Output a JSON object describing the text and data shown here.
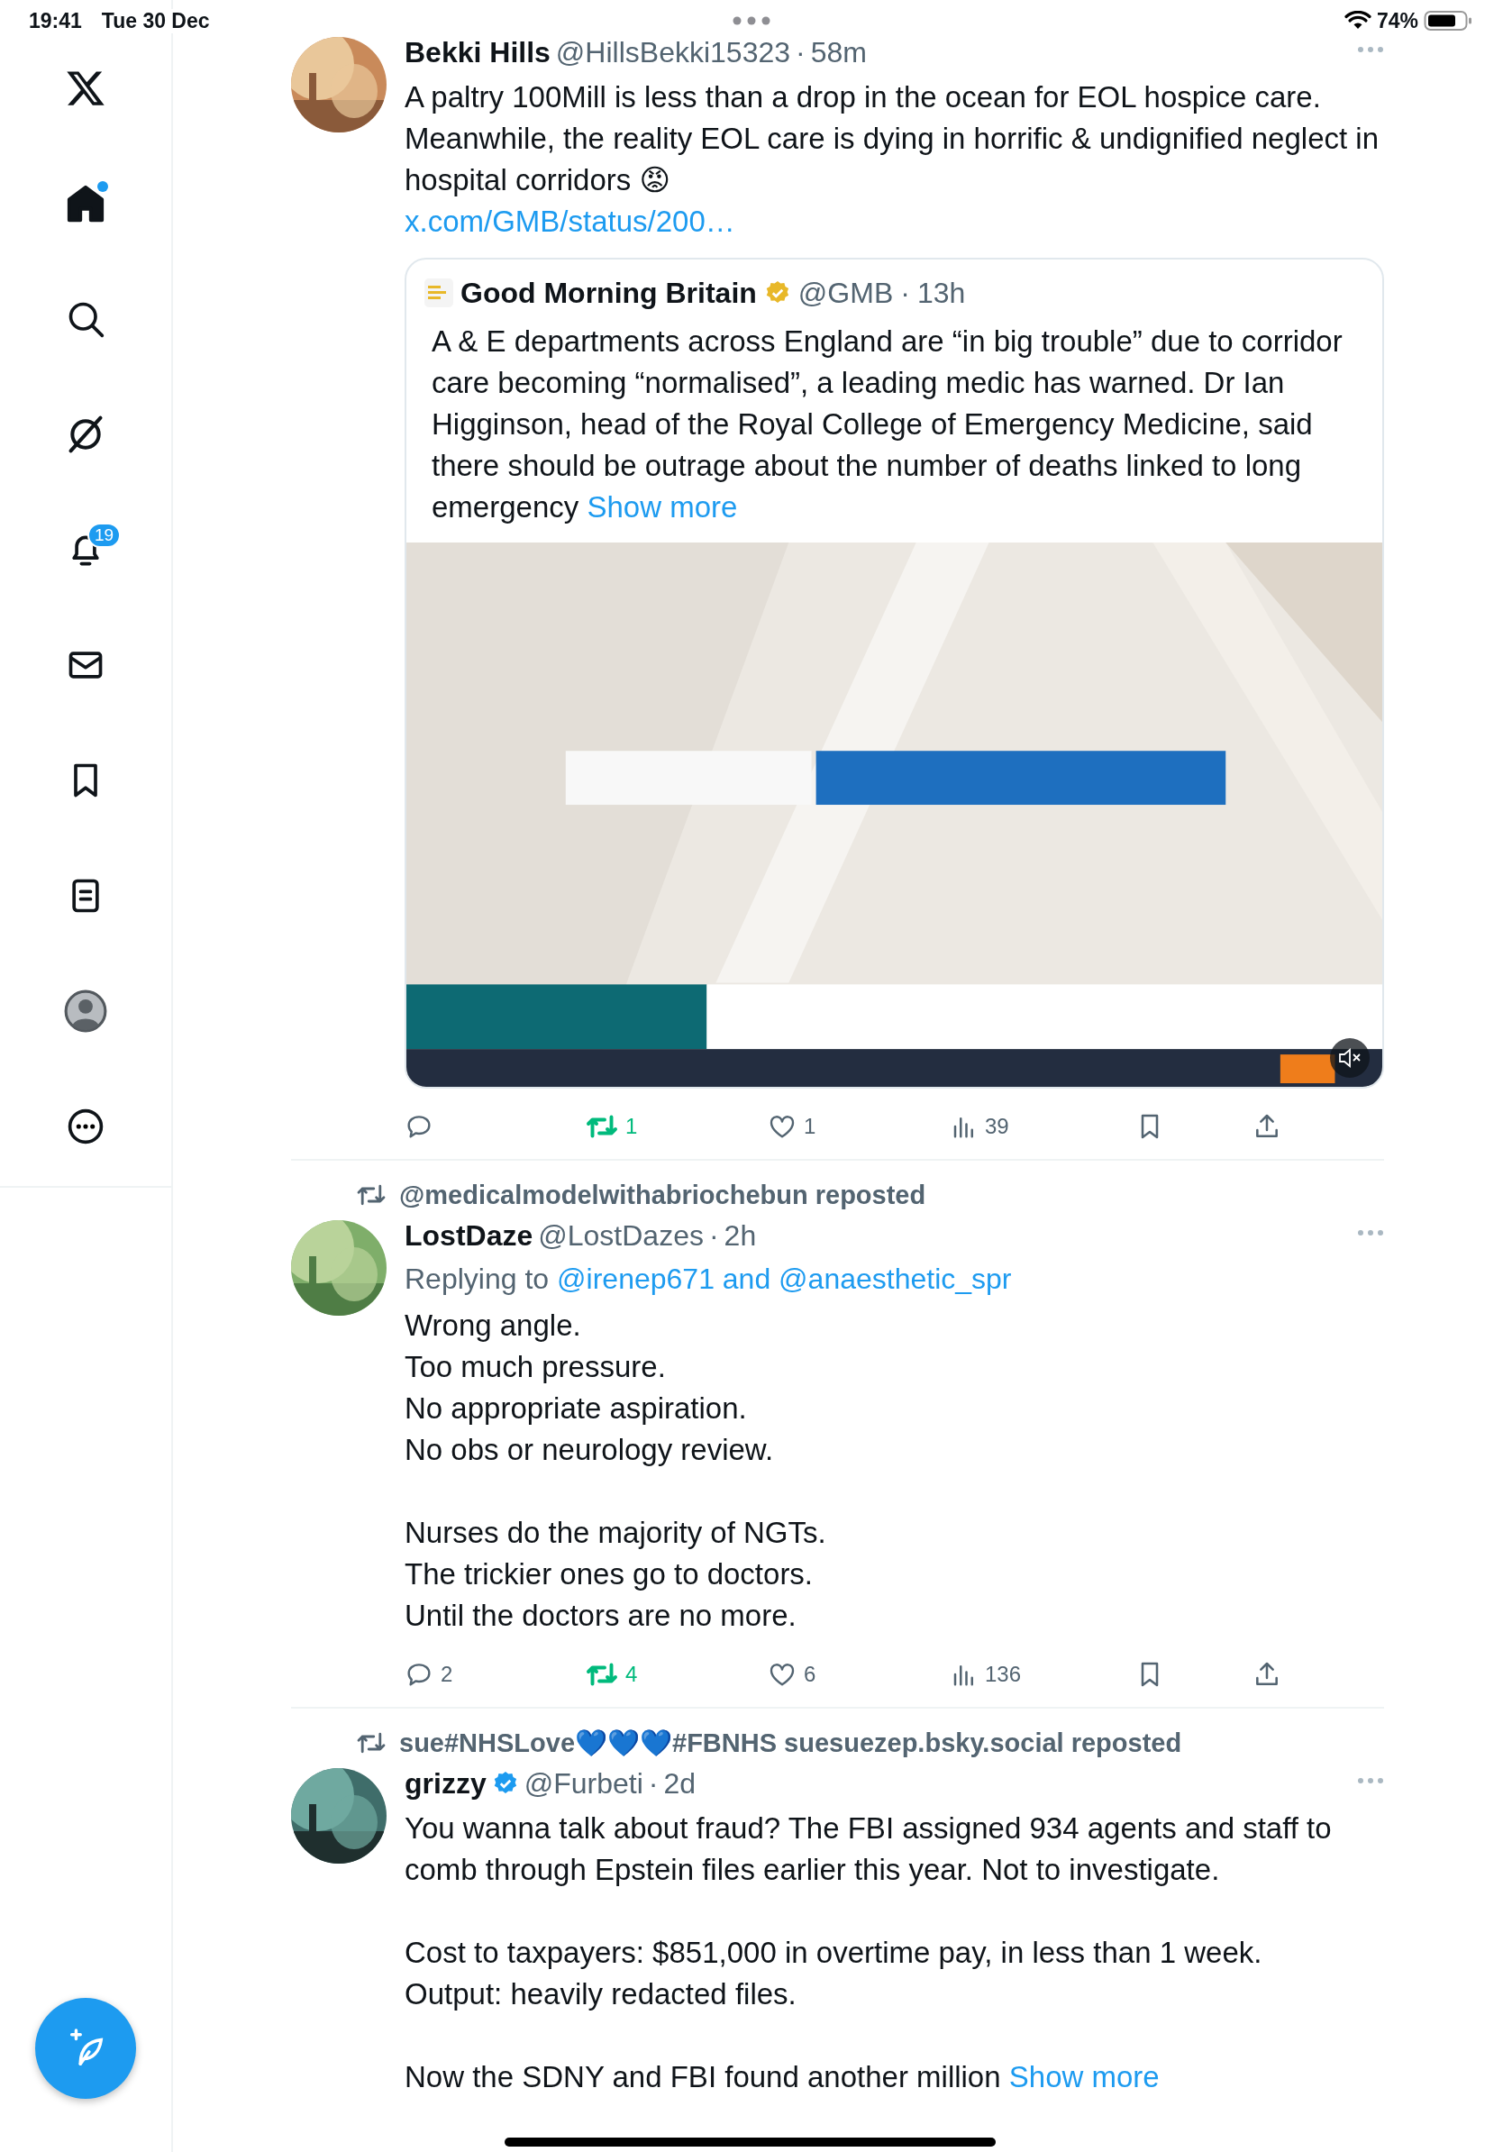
{
  "status_bar": {
    "time": "19:41",
    "date": "Tue 30 Dec",
    "battery": "74%"
  },
  "sidebar": {
    "items": [
      {
        "selected": false
      },
      {
        "selected": true,
        "unread": true
      },
      {
        "selected": false
      },
      {
        "selected": false
      },
      {
        "selected": false,
        "badge": "19"
      },
      {
        "selected": false
      },
      {
        "selected": false
      },
      {
        "selected": false
      },
      {
        "selected": false
      },
      {
        "selected": false
      }
    ]
  },
  "tweets": [
    {
      "author": "Bekki Hills",
      "handle": "@HillsBekki15323",
      "separator": "·",
      "time": "58m",
      "text": "A paltry 100Mill is less than a drop in the ocean for EOL hospice care. Meanwhile, the reality EOL care is dying in horrific & undignified neglect in hospital corridors 😡",
      "link": "x.com/GMB/status/200…",
      "quote": {
        "author": "Good Morning Britain",
        "verified": {
          "kind": "gold"
        },
        "handle": "@GMB",
        "separator": "·",
        "time": "13h",
        "text": "A & E departments across England are “in big trouble” due to corridor care becoming “normalised”, a leading medic has warned. Dr Ian Higginson, head of the Royal College of Emergency Medicine, said there should be outrage about the number of deaths linked to long emergency",
        "show_more": "Show more",
        "media": {
          "kind": "picture",
          "muted": true
        }
      },
      "actions": {
        "reposts": "1",
        "reposted": true,
        "likes": "1",
        "liked": false,
        "views": "39"
      }
    },
    {
      "reposted_by": "@medicalmodelwithabriochebun reposted",
      "author": "LostDaze",
      "handle": "@LostDazes",
      "separator": "·",
      "time": "2h",
      "replying_prefix": "Replying to",
      "replying_to": "@irenep671 and @anaesthetic_spr",
      "text": "Wrong angle.\nToo much pressure.\nNo appropriate aspiration.\nNo obs or neurology review.\n\nNurses do the majority of NGTs.\nThe trickier ones go to doctors.\nUntil the doctors are no more.",
      "actions": {
        "replies": "2",
        "reposts": "4",
        "reposted": true,
        "likes": "6",
        "liked": false,
        "views": "136"
      }
    },
    {
      "reposted_by": "sue#NHSLove💙💙💙#FBNHS suesuezep.bsky.social reposted",
      "author": "grizzy",
      "verified": {
        "kind": "blue"
      },
      "handle": "@Furbeti",
      "separator": "·",
      "time": "2d",
      "text": "You wanna talk about fraud? The FBI assigned 934 agents and staff to comb through Epstein files earlier this year. Not to investigate.\n\nCost to taxpayers: $851,000 in overtime pay, in less than 1 week.\nOutput: heavily redacted files.\n\nNow the SDNY and FBI found another million",
      "show_more": "Show more"
    }
  ]
}
